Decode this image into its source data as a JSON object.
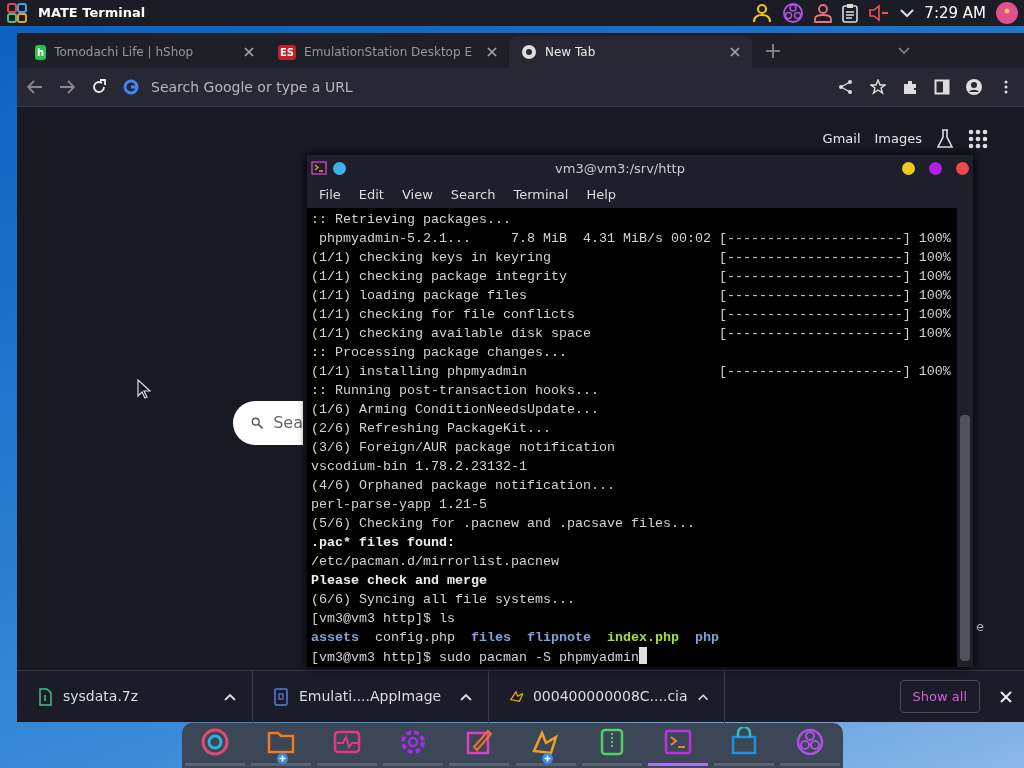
{
  "top_panel": {
    "title": "MATE Terminal",
    "clock": "7:29 AM"
  },
  "browser": {
    "tabs": [
      {
        "title": "Tomodachi Life | hShop",
        "kind": "hshop",
        "badge": "h",
        "selected": false
      },
      {
        "title": "EmulationStation Desktop E",
        "kind": "es",
        "badge": "ES",
        "selected": false
      },
      {
        "title": "New Tab",
        "kind": "chrome",
        "selected": true
      }
    ],
    "address_bar": {
      "placeholder": "Search Google or type a URL"
    },
    "links": [
      "Gmail",
      "Images"
    ],
    "search_box": {
      "placeholder": "Sea"
    },
    "shortcut_fragment": "e",
    "downloads": [
      {
        "name": "sysdata.7z",
        "kind": "archive"
      },
      {
        "name": "Emulati....AppImage",
        "kind": "appimage"
      },
      {
        "name": "000400000008C....cia",
        "kind": "cia"
      }
    ],
    "show_all": "Show all"
  },
  "terminal": {
    "title": "vm3@vm3:/srv/http",
    "menu": [
      "File",
      "Edit",
      "View",
      "Search",
      "Terminal",
      "Help"
    ],
    "lines": [
      {
        "kind": "text",
        "text": ":: Retrieving packages..."
      },
      {
        "kind": "text",
        "text": " phpmyadmin-5.2.1...     7.8 MiB  4.31 MiB/s 00:02 [----------------------] 100%"
      },
      {
        "kind": "text",
        "text": "(1/1) checking keys in keyring                     [----------------------] 100%"
      },
      {
        "kind": "text",
        "text": "(1/1) checking package integrity                   [----------------------] 100%"
      },
      {
        "kind": "text",
        "text": "(1/1) loading package files                        [----------------------] 100%"
      },
      {
        "kind": "text",
        "text": "(1/1) checking for file conflicts                  [----------------------] 100%"
      },
      {
        "kind": "text",
        "text": "(1/1) checking available disk space                [----------------------] 100%"
      },
      {
        "kind": "text",
        "text": ":: Processing package changes..."
      },
      {
        "kind": "text",
        "text": "(1/1) installing phpmyadmin                        [----------------------] 100%"
      },
      {
        "kind": "text",
        "text": ":: Running post-transaction hooks..."
      },
      {
        "kind": "text",
        "text": "(1/6) Arming ConditionNeedsUpdate..."
      },
      {
        "kind": "text",
        "text": "(2/6) Refreshing PackageKit..."
      },
      {
        "kind": "text",
        "text": "(3/6) Foreign/AUR package notification"
      },
      {
        "kind": "text",
        "text": "vscodium-bin 1.78.2.23132-1"
      },
      {
        "kind": "text",
        "text": "(4/6) Orphaned package notification..."
      },
      {
        "kind": "text",
        "text": "perl-parse-yapp 1.21-5"
      },
      {
        "kind": "text",
        "text": "(5/6) Checking for .pacnew and .pacsave files..."
      },
      {
        "kind": "bold",
        "text": ".pac* files found:"
      },
      {
        "kind": "text",
        "text": "/etc/pacman.d/mirrorlist.pacnew"
      },
      {
        "kind": "bold",
        "text": "Please check and merge"
      },
      {
        "kind": "text",
        "text": "(6/6) Syncing all file systems..."
      },
      {
        "kind": "text",
        "text": "[vm3@vm3 http]$ ls"
      },
      {
        "kind": "ls",
        "entries": [
          {
            "name": "assets",
            "kind": "dir"
          },
          {
            "name": "config.php",
            "kind": "file"
          },
          {
            "name": "files",
            "kind": "dir"
          },
          {
            "name": "flipnote",
            "kind": "dir"
          },
          {
            "name": "index.php",
            "kind": "exec"
          },
          {
            "name": "php",
            "kind": "dir"
          }
        ]
      },
      {
        "kind": "prompt",
        "text": "[vm3@vm3 http]$ sudo pacman -S phpmyadmin"
      }
    ]
  },
  "dock": [
    {
      "kind": "chrome",
      "badge": false,
      "active": false
    },
    {
      "kind": "files",
      "badge": true,
      "active": false
    },
    {
      "kind": "monitor",
      "badge": false,
      "active": false
    },
    {
      "kind": "settings",
      "badge": false,
      "active": false
    },
    {
      "kind": "editor",
      "badge": false,
      "active": false
    },
    {
      "kind": "citra",
      "badge": true,
      "active": false
    },
    {
      "kind": "archive",
      "badge": false,
      "active": false
    },
    {
      "kind": "terminal",
      "badge": false,
      "active": true
    },
    {
      "kind": "store",
      "badge": false,
      "active": false
    },
    {
      "kind": "obs",
      "badge": false,
      "active": false
    }
  ]
}
